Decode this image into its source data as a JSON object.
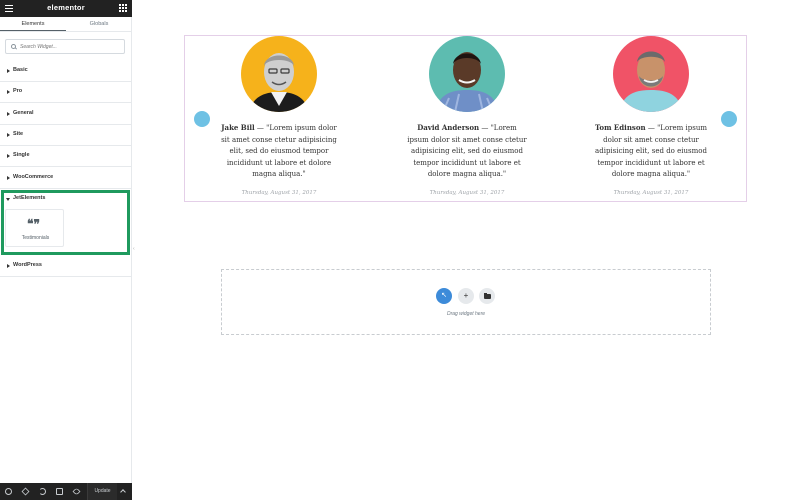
{
  "app": {
    "logo": "elementor"
  },
  "tabs": [
    {
      "label": "Elements",
      "active": true
    },
    {
      "label": "Globals",
      "active": false
    }
  ],
  "search": {
    "placeholder": "Search Widget..."
  },
  "categories": [
    {
      "label": "Basic",
      "expanded": false
    },
    {
      "label": "Pro",
      "expanded": false
    },
    {
      "label": "General",
      "expanded": false
    },
    {
      "label": "Site",
      "expanded": false
    },
    {
      "label": "Single",
      "expanded": false
    },
    {
      "label": "WooCommerce",
      "expanded": false
    },
    {
      "label": "JetElements",
      "expanded": true
    },
    {
      "label": "WordPress",
      "expanded": false
    }
  ],
  "widget": {
    "label": "Testimonials",
    "icon": "quote-icon"
  },
  "footer": {
    "update_label": "Update"
  },
  "testimonials": [
    {
      "name": "Jake Bill",
      "text": " — \"Lorem ipsum dolor sit amet conse ctetur adipisicing elit, sed do eiusmod tempor incididunt ut labore et dolore magna aliqua.\"",
      "date": "Thursday, August 31, 2017",
      "bg": "#f6b21b"
    },
    {
      "name": "David Anderson",
      "text": " — \"Lorem ipsum dolor sit amet conse ctetur adipisicing elit, sed do eiusmod tempor incididunt ut labore et dolore magna aliqua.\"",
      "date": "Thursday, August 31, 2017",
      "bg": "#5dbcb0"
    },
    {
      "name": "Tom Edinson",
      "text": " — \"Lorem ipsum dolor sit amet conse ctetur adipisicing elit, sed do eiusmod tempor incididunt ut labore et dolore magna aliqua.\"",
      "date": "Thursday, August 31, 2017",
      "bg": "#f05367"
    }
  ],
  "dropzone": {
    "text": "Drag widget here"
  },
  "colors": {
    "accent": "#1f9a5e",
    "arrow": "#6ec1e4",
    "edit": "#3d8bd9"
  }
}
